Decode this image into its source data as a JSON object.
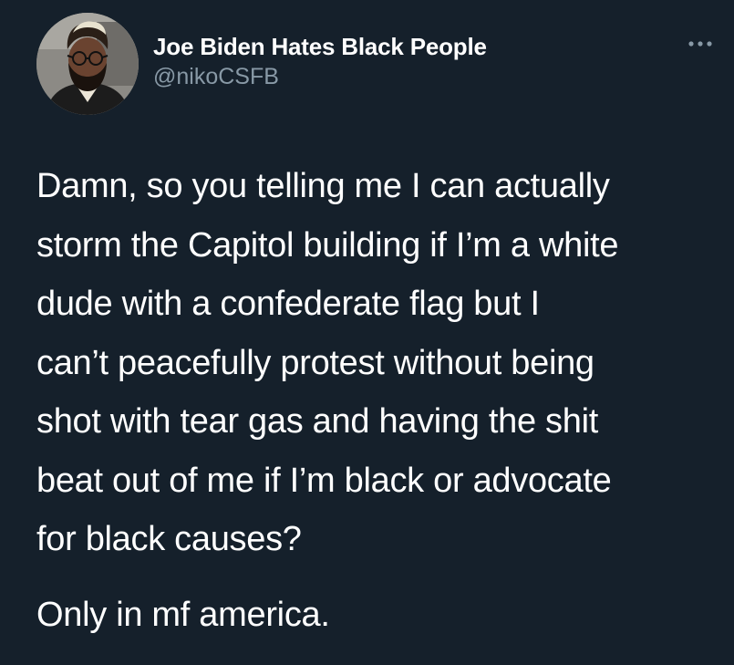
{
  "tweet": {
    "author": {
      "display_name": "Joe Biden Hates Black People",
      "handle": "@nikoCSFB",
      "avatar_icon": "avatar-photo"
    },
    "more_icon": "more-options-icon",
    "body_lines": [
      "Damn, so you telling me I can actually",
      "storm the Capitol building if I’m a white",
      "dude with a confederate flag but I",
      "can’t peacefully protest without being",
      "shot with tear gas and having the shit",
      "beat out of me if I’m black or advocate",
      "for black causes?"
    ],
    "body_closing": "Only in mf america."
  },
  "colors": {
    "background": "#15202b",
    "primary_text": "#ffffff",
    "secondary_text": "#8899a6"
  }
}
